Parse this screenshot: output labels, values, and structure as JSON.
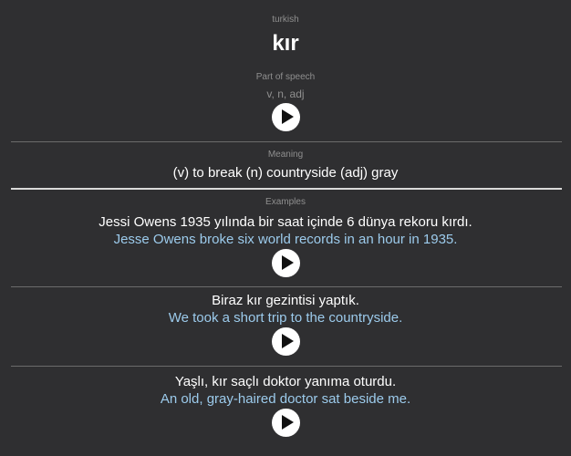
{
  "language_label": "turkish",
  "word": "kır",
  "part_of_speech_label": "Part of speech",
  "part_of_speech_value": "v, n, adj",
  "meaning_label": "Meaning",
  "meaning_value": "(v) to break (n) countryside (adj) gray",
  "examples_label": "Examples",
  "examples": [
    {
      "sentence": "Jessi Owens 1935 yılında bir saat içinde 6 dünya rekoru kırdı.",
      "translation": "Jesse Owens broke six world records in an hour in 1935."
    },
    {
      "sentence": "Biraz kır gezintisi yaptık.",
      "translation": "We took a short trip to the countryside."
    },
    {
      "sentence": "Yaşlı, kır saçlı doktor yanıma oturdu.",
      "translation": "An old, gray-haired doctor sat beside me."
    }
  ],
  "icons": {
    "play": "play-icon"
  },
  "colors": {
    "background": "#2f2f31",
    "translation_text": "#9ccbec",
    "muted_text": "#8f8f8f",
    "play_button_bg": "#ffffff"
  }
}
